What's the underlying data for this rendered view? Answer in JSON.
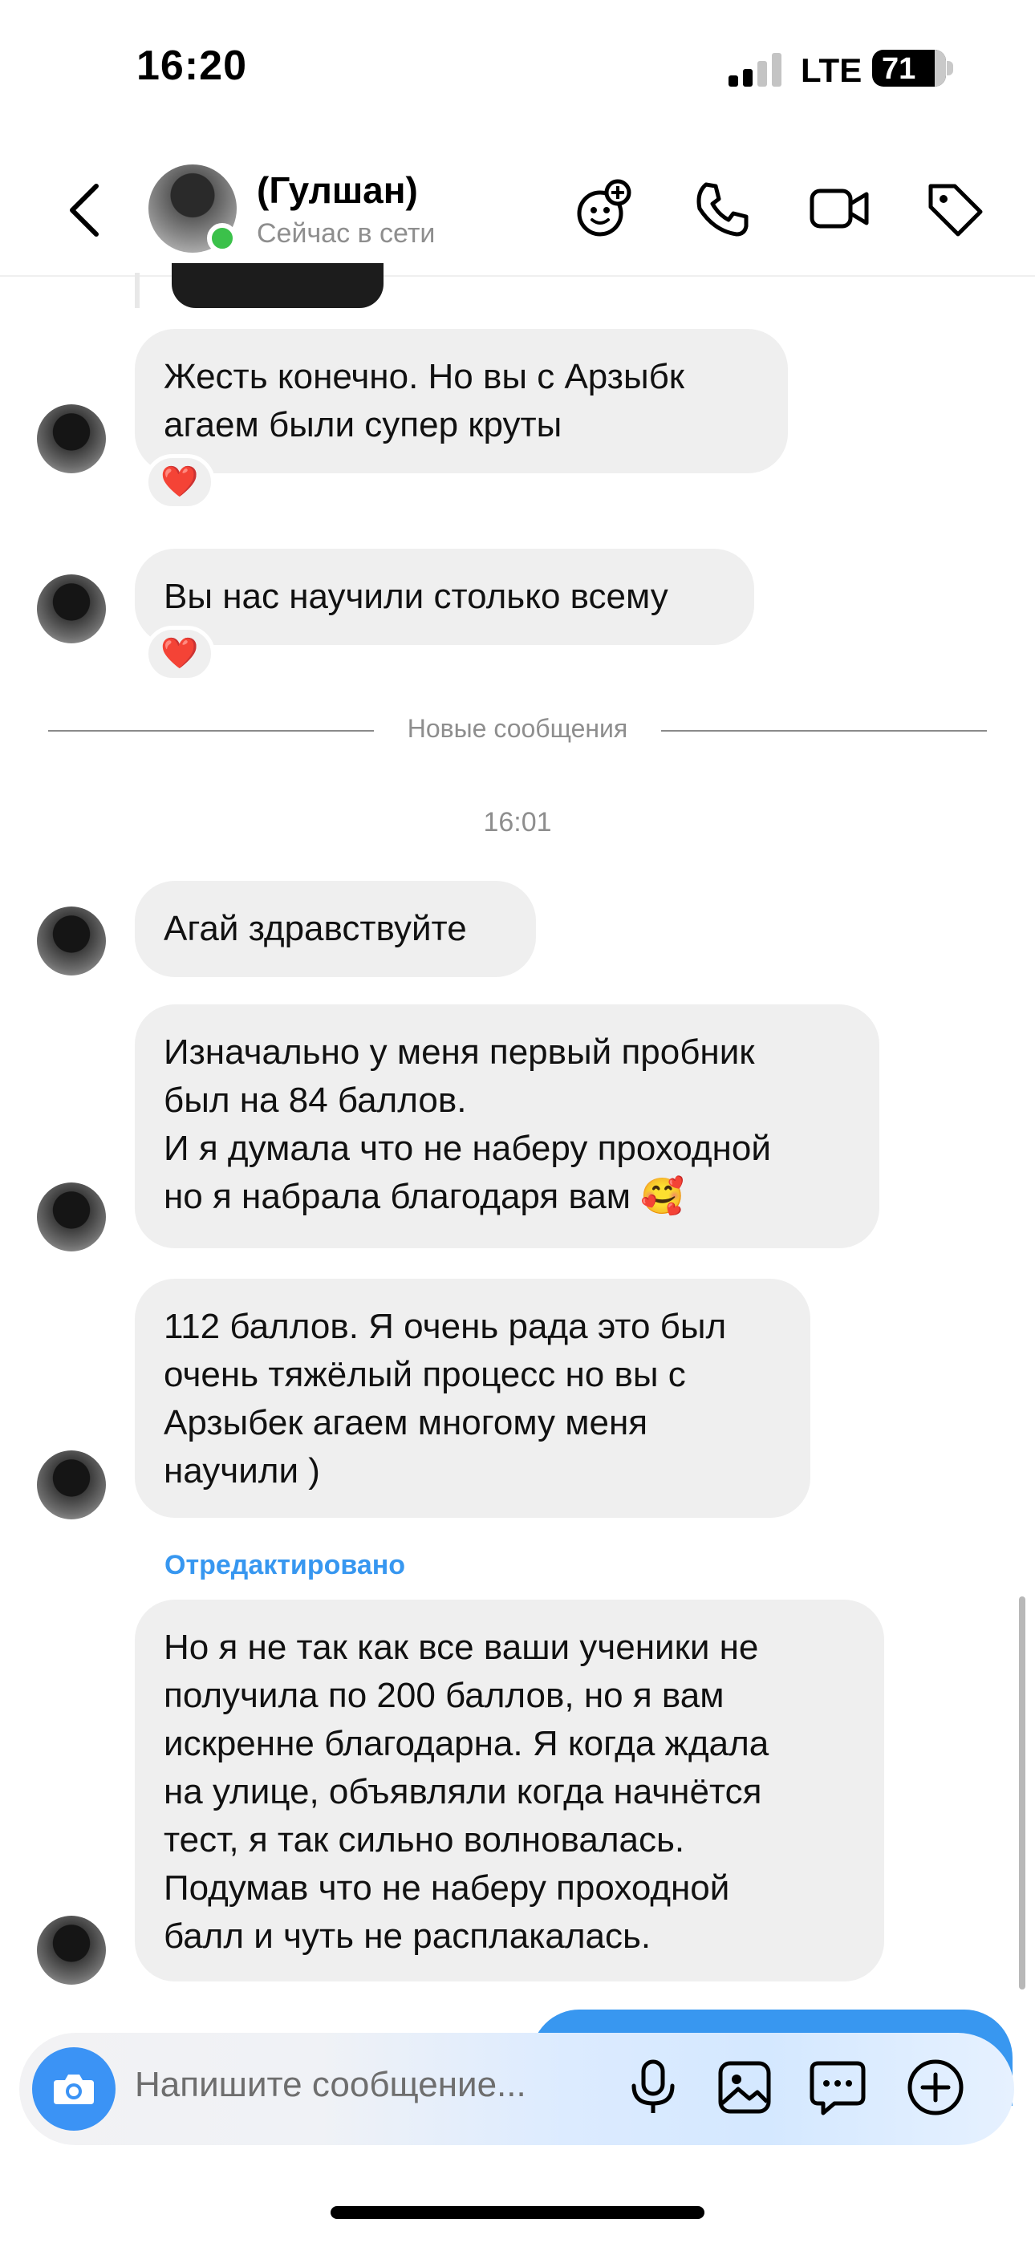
{
  "status_bar": {
    "time": "16:20",
    "network": "LTE",
    "battery": "71"
  },
  "header": {
    "back_icon": "chevron-left-icon",
    "name": "(Гулшан)",
    "status": "Сейчас в сети",
    "online_color": "#3bc14a",
    "actions": [
      "add-effects-icon",
      "phone-icon",
      "video-icon",
      "tag-icon"
    ]
  },
  "messages": [
    {
      "text": "Жесть конечно. Но вы с Арзыбк\nагаем были супер круты",
      "reaction": "❤️"
    },
    {
      "text": "Вы нас научили столько всему",
      "reaction": "❤️"
    },
    {
      "text": "Агай здравствуйте"
    },
    {
      "text": "Изначально у меня первый пробник\nбыл на 84 баллов.\nИ я думала что не наберу проходной\nно я набрала благодаря вам 🥰"
    },
    {
      "text": "112 баллов. Я очень рада это был\nочень тяжёлый процесс но вы с\nАрзыбек агаем многому меня\nнаучили )"
    },
    {
      "text": "Но я не так как все ваши ученики не\nполучила по 200  баллов, но я вам\nискренне благодарна. Я когда ждала\nна улице, объявляли когда начнётся\nтест, я так сильно волновалась.\nПодумав что не наберу проходной\nбалл и чуть не расплакалась."
    }
  ],
  "separator_label": "Новые сообщения",
  "timestamp": "16:01",
  "edited_label": "Отредактировано",
  "composer": {
    "placeholder": "Напишите сообщение...",
    "camera_color": "#3b93f5",
    "icons": [
      "camera-icon",
      "microphone-icon",
      "gallery-icon",
      "sticker-icon",
      "plus-icon"
    ]
  },
  "colors": {
    "bubble": "#efefef",
    "accent": "#3797f0"
  }
}
